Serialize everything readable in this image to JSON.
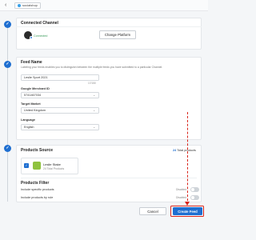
{
  "header": {
    "brand": "socialshop"
  },
  "steps": [
    "✓",
    "✓",
    "✓"
  ],
  "connected_channel": {
    "title": "Connected Channel",
    "status": "Connected",
    "change_button": "Change Platform"
  },
  "feed_name": {
    "title": "Feed Name",
    "description": "Labeling your feeds enables you to distinguish between the multiple feeds you have submitted to a particular Channel.",
    "name_value": "Leslie Sport 2021",
    "counter": "17/150",
    "merchant_label": "Google Merchant ID",
    "merchant_value": "5741467034",
    "market_label": "Target Market",
    "market_value": "United Kingdom",
    "language_label": "Language",
    "language_value": "English"
  },
  "products_source": {
    "title": "Products Source",
    "total_count": "24",
    "total_suffix": "Total products",
    "store_name": "Leslie Stake",
    "store_count": "24 Total Products"
  },
  "products_filter": {
    "title": "Products Filter",
    "rows": [
      {
        "label": "Include specific products",
        "state": "Disabled"
      },
      {
        "label": "Include products by rule",
        "state": "Disabled"
      }
    ]
  },
  "footer": {
    "cancel": "Cancel",
    "create": "Create Feed"
  },
  "colors": {
    "primary": "#1f6fd1",
    "annotation": "#d9261c",
    "success": "#3a9b5a"
  }
}
